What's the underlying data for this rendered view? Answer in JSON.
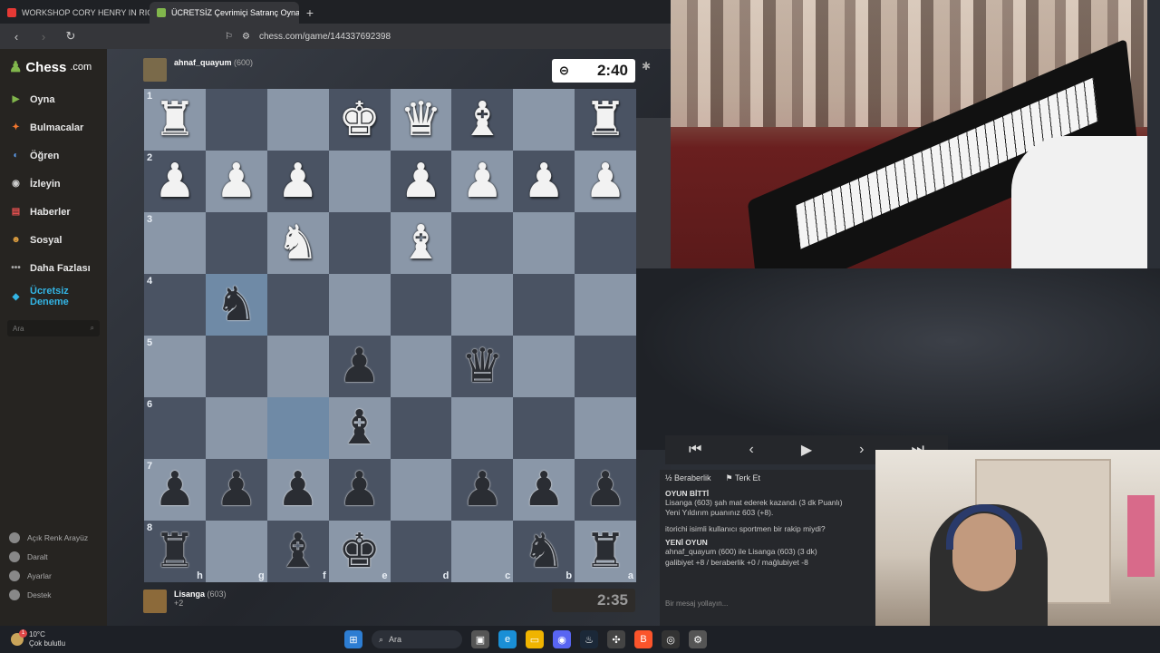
{
  "browser": {
    "tabs": [
      {
        "title": "WORKSHOP CORY HENRY IN RIO",
        "favicon_color": "#e53935"
      },
      {
        "title": "ÜCRETSİZ Çevrimiçi Satranç Oyna",
        "favicon_color": "#81b64c",
        "active": true
      }
    ],
    "url": "chess.com/game/144337692398"
  },
  "sidebar": {
    "logo": "Chess",
    "logo_suffix": ".com",
    "items": [
      {
        "label": "Oyna",
        "icon": "play-icon",
        "color": "#81b64c"
      },
      {
        "label": "Bulmacalar",
        "icon": "puzzle-icon",
        "color": "#f4772e"
      },
      {
        "label": "Öğren",
        "icon": "learn-icon",
        "color": "#5d9cec"
      },
      {
        "label": "İzleyin",
        "icon": "watch-icon",
        "color": "#cccccc"
      },
      {
        "label": "Haberler",
        "icon": "news-icon",
        "color": "#e35050"
      },
      {
        "label": "Sosyal",
        "icon": "social-icon",
        "color": "#e0a040"
      },
      {
        "label": "Daha Fazlası",
        "icon": "more-icon",
        "color": "#aaaaaa"
      }
    ],
    "trial_line1": "Ücretsiz",
    "trial_line2": "Deneme",
    "search_placeholder": "Ara",
    "bottom": [
      {
        "label": "Açık Renk Arayüz",
        "icon": "theme-icon"
      },
      {
        "label": "Daralt",
        "icon": "collapse-icon"
      },
      {
        "label": "Ayarlar",
        "icon": "settings-icon"
      },
      {
        "label": "Destek",
        "icon": "help-icon"
      }
    ]
  },
  "game": {
    "top_player": {
      "name": "ahnaf_quayum",
      "rating": "(600)"
    },
    "bottom_player": {
      "name": "Lisanga",
      "rating": "(603)",
      "material": "+2"
    },
    "top_clock": "2:40",
    "bottom_clock": "2:35",
    "ranks": [
      "1",
      "2",
      "3",
      "4",
      "5",
      "6",
      "7",
      "8"
    ],
    "files": [
      "h",
      "g",
      "f",
      "e",
      "d",
      "c",
      "b",
      "a"
    ],
    "board": [
      [
        "wR",
        "",
        "",
        "wK",
        "wQ",
        "wB",
        "",
        "wR"
      ],
      [
        "wP",
        "wP",
        "wP",
        "",
        "wP",
        "wP",
        "wP",
        "wP"
      ],
      [
        "",
        "",
        "wN",
        "",
        "wB",
        "",
        "",
        ""
      ],
      [
        "",
        "bN",
        "",
        "",
        "",
        "",
        "",
        ""
      ],
      [
        "",
        "",
        "",
        "bP",
        "",
        "bQ",
        "",
        ""
      ],
      [
        "",
        "",
        "",
        "bB",
        "",
        "",
        "",
        ""
      ],
      [
        "bP",
        "bP",
        "bP",
        "bP",
        "",
        "bP",
        "bP",
        "bP"
      ],
      [
        "bR",
        "",
        "bB",
        "bK",
        "",
        "",
        "bN",
        "bR"
      ]
    ],
    "highlighted": [
      [
        3,
        1
      ],
      [
        5,
        2
      ]
    ]
  },
  "controls": {
    "first": "⏮",
    "prev": "‹",
    "play": "▶",
    "next": "›",
    "last": "⏭"
  },
  "chat": {
    "draw": "Beraberlik",
    "resign": "Terk Et",
    "game_over": "OYUN BİTTİ",
    "result_line": "Lisanga (603) şah mat ederek kazandı (3 dk Puanlı)",
    "rating_line": "Yeni Yıldırım puanınız 603 (+8).",
    "sportsman_line": "itorichi isimli kullanıcı sportmen bir rakip miydi?",
    "new_game": "YENİ OYUN",
    "new_game_line": "ahnaf_quayum (600) ile Lisanga (603) (3 dk)",
    "stats_line": "galibiyet +8 / beraberlik +0 / mağlubiyet -8",
    "input_placeholder": "Bir mesaj yollayın..."
  },
  "taskbar": {
    "temp": "10°C",
    "weather": "Çok bulutlu",
    "badge": "1",
    "search": "Ara"
  }
}
